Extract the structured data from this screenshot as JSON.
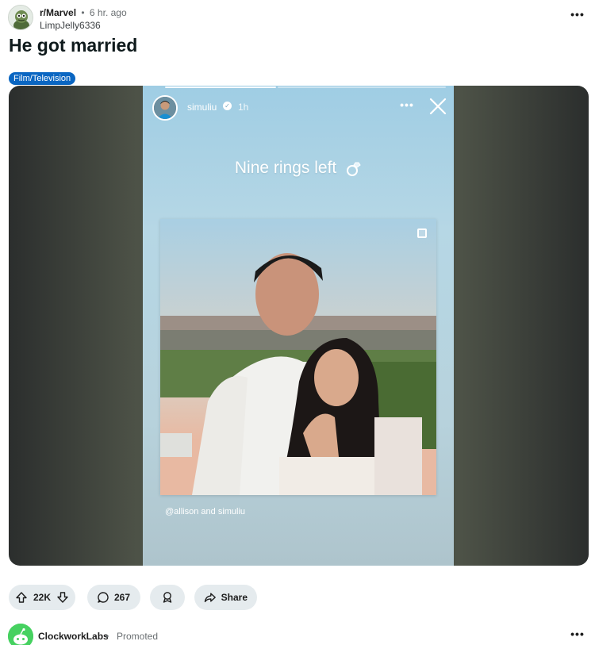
{
  "post": {
    "subreddit": "r/Marvel",
    "separator": "•",
    "age": "6 hr. ago",
    "author": "LimpJelly6336",
    "more": "•••",
    "title": "He got married",
    "flair": "Film/Television"
  },
  "story": {
    "username": "simuliu",
    "verified": "✓",
    "time": "1h",
    "more": "•••",
    "caption": "Nine rings left",
    "credit": "@allison and simuliu"
  },
  "actions": {
    "upvotes": "22K",
    "comments": "267",
    "share": "Share"
  },
  "promoted": {
    "name": "ClockworkLabs",
    "separator": "•",
    "tag": "Promoted",
    "more": "•••"
  },
  "colors": {
    "flair_bg": "#0a66c2",
    "pill_bg": "#e5ebee",
    "promo_avatar": "#46d160"
  }
}
